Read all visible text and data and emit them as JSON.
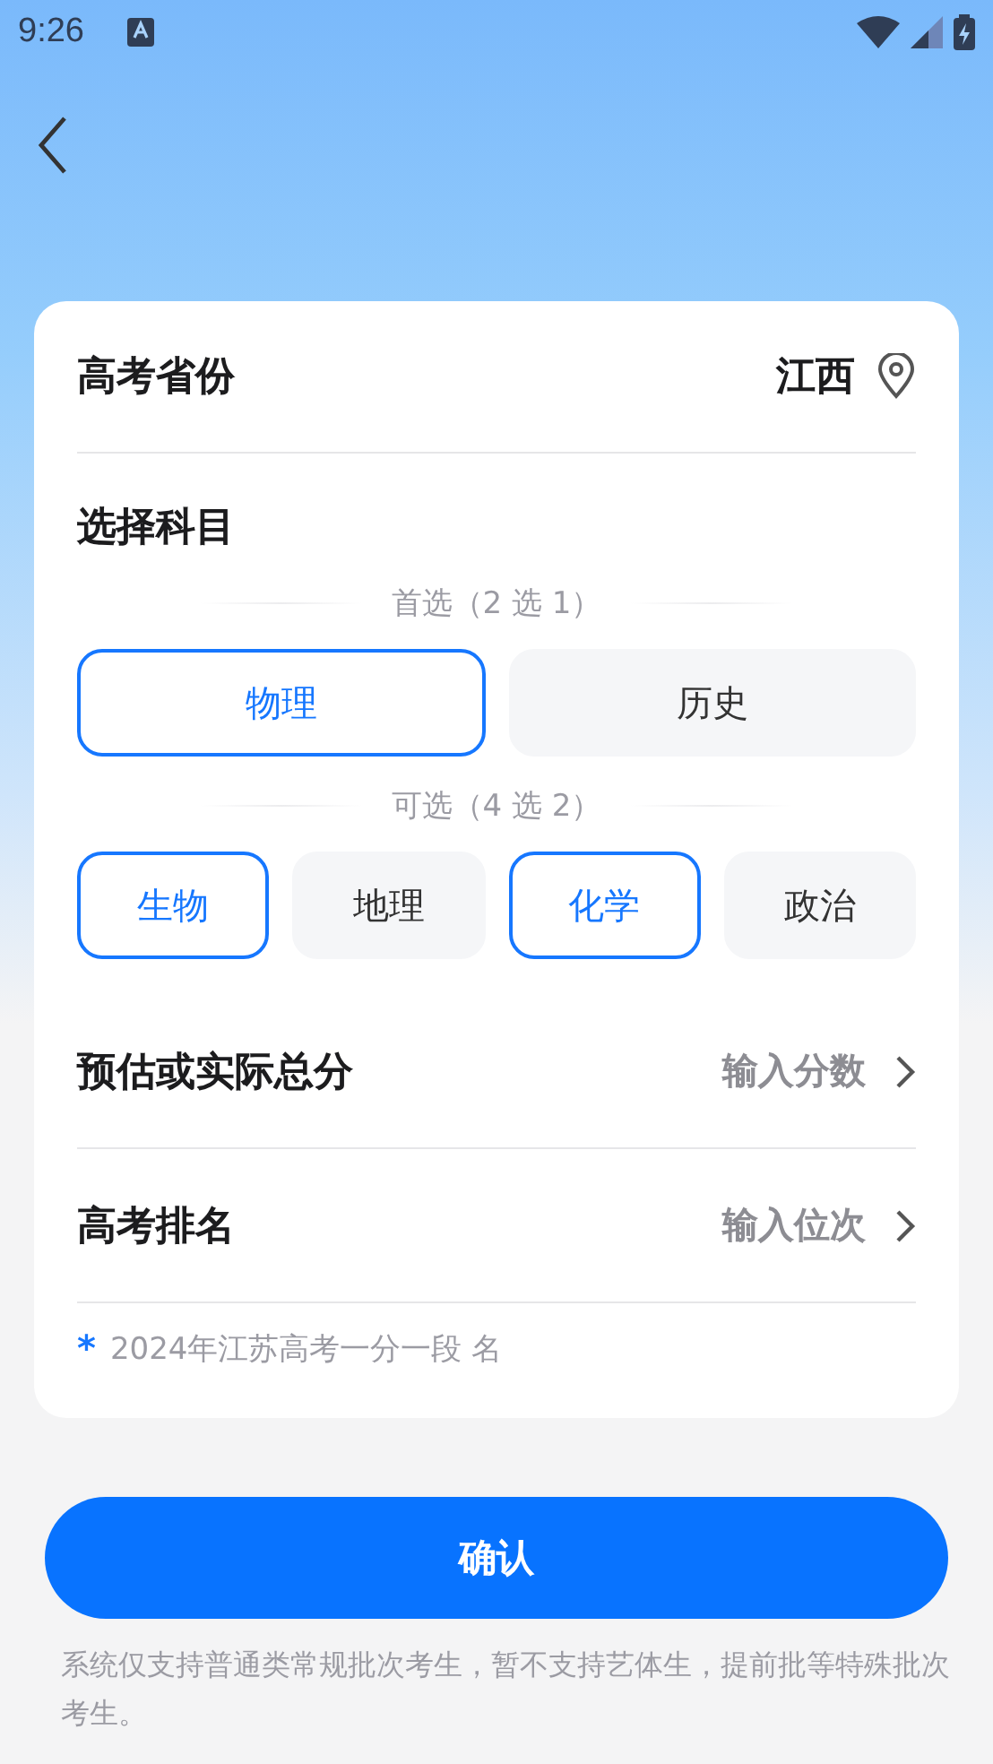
{
  "status_bar": {
    "time": "9:26"
  },
  "province": {
    "label": "高考省份",
    "value": "江西"
  },
  "subjects": {
    "title": "选择科目",
    "groups": [
      {
        "caption": "首选（2 选 1）",
        "options": [
          {
            "label": "物理",
            "selected": true
          },
          {
            "label": "历史",
            "selected": false
          }
        ]
      },
      {
        "caption": "可选（4 选 2）",
        "options": [
          {
            "label": "生物",
            "selected": true
          },
          {
            "label": "地理",
            "selected": false
          },
          {
            "label": "化学",
            "selected": true
          },
          {
            "label": "政治",
            "selected": false
          }
        ]
      }
    ]
  },
  "inputs": [
    {
      "label": "预估或实际总分",
      "placeholder": "输入分数"
    },
    {
      "label": "高考排名",
      "placeholder": "输入位次"
    }
  ],
  "footnote": {
    "mark": "*",
    "text": "2024年江苏高考一分一段 名"
  },
  "confirm_button": "确认",
  "notice": "系统仅支持普通类常规批次考生，暂不支持艺体生，提前批等特殊批次考生。"
}
